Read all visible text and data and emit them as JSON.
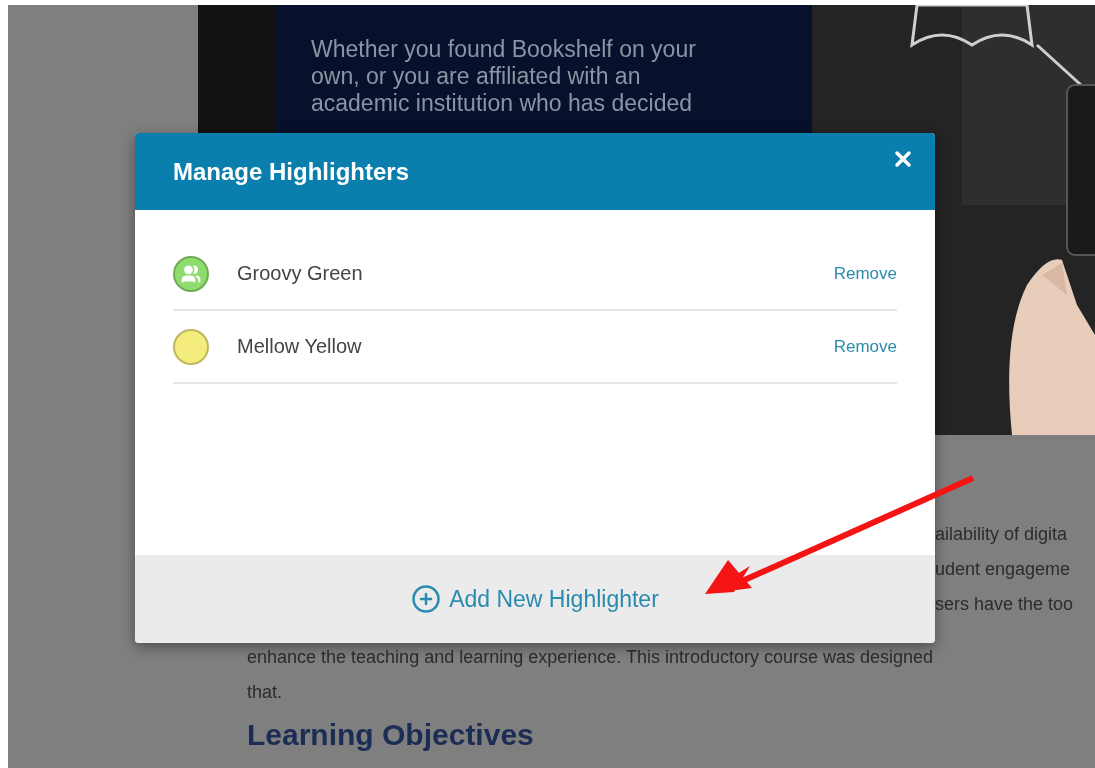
{
  "hero": {
    "text_lines": [
      "Whether you found Bookshelf on your",
      "own, or you are affiliated with an",
      "academic institution who has decided"
    ]
  },
  "page": {
    "fragments": [
      "ailability of digita",
      "udent engageme",
      "sers have the too"
    ],
    "lines": [
      "enhance the teaching and learning experience.  This introductory course was designed",
      "that."
    ],
    "heading": "Learning Objectives"
  },
  "dialog": {
    "title": "Manage Highlighters",
    "highlighters": [
      {
        "name": "Groovy Green",
        "color": "#8fdc6e",
        "shared": true,
        "action": "Remove"
      },
      {
        "name": "Mellow Yellow",
        "color": "#f4ec7c",
        "shared": false,
        "action": "Remove"
      }
    ],
    "add_button": "Add New Highlighter"
  }
}
